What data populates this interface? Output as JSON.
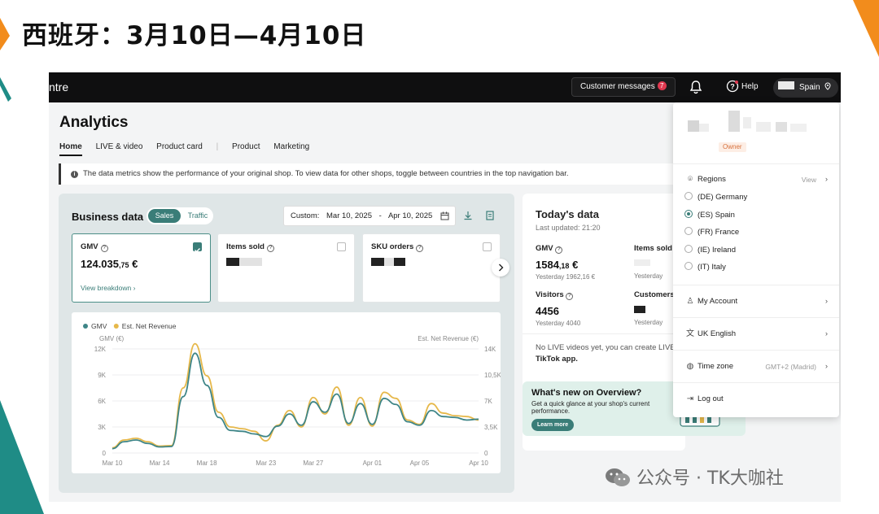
{
  "slide": {
    "title": "西班牙：3月10日—4月10日",
    "watermark": "公众号 · TK大咖社"
  },
  "topbar": {
    "brand_fragment": "ntre",
    "customer_messages": "Customer messages",
    "customer_messages_count": "7",
    "help": "Help",
    "region": "Spain"
  },
  "page": {
    "title": "Analytics",
    "tabs": [
      "Home",
      "LIVE & video",
      "Product card",
      "Product",
      "Marketing"
    ],
    "notice": "The data metrics show the performance of your original shop. To view data for other shops, toggle between countries in the top navigation bar."
  },
  "business": {
    "title": "Business data",
    "toggle": {
      "on": "Sales",
      "off": "Traffic"
    },
    "date": {
      "label": "Custom:",
      "start": "Mar 10, 2025",
      "dash": "-",
      "end": "Apr 10, 2025"
    },
    "cards": [
      {
        "label": "GMV",
        "value_main": "124.035",
        "value_dec": ",75",
        "currency": "€",
        "link": "View breakdown ›",
        "selected": true
      },
      {
        "label": "Items sold",
        "selected": false
      },
      {
        "label": "SKU orders",
        "selected": false
      }
    ]
  },
  "chart_data": {
    "type": "line",
    "title": "",
    "legend": [
      "GMV",
      "Est. Net Revenue"
    ],
    "ylabel_left": "GMV (€)",
    "ylabel_right": "Est. Net Revenue (€)",
    "x_ticks": [
      "Mar 10",
      "Mar 14",
      "Mar 18",
      "Mar 23",
      "Mar 27",
      "Apr 01",
      "Apr 05",
      "Apr 10"
    ],
    "y_ticks_left": [
      "12K",
      "9K",
      "6K",
      "3K",
      "0"
    ],
    "y_ticks_right": [
      "14K",
      "10,5K",
      "7K",
      "3,5K",
      "0"
    ],
    "ylim_left": [
      0,
      12000
    ],
    "colors": {
      "GMV": "#3e8587",
      "Est. Net Revenue": "#e6b84a"
    },
    "x": [
      "Mar 10",
      "Mar 11",
      "Mar 12",
      "Mar 13",
      "Mar 14",
      "Mar 15",
      "Mar 16",
      "Mar 17",
      "Mar 18",
      "Mar 19",
      "Mar 20",
      "Mar 21",
      "Mar 22",
      "Mar 23",
      "Mar 24",
      "Mar 25",
      "Mar 26",
      "Mar 27",
      "Mar 28",
      "Mar 29",
      "Mar 30",
      "Mar 31",
      "Apr 01",
      "Apr 02",
      "Apr 03",
      "Apr 04",
      "Apr 05",
      "Apr 06",
      "Apr 07",
      "Apr 08",
      "Apr 09",
      "Apr 10"
    ],
    "series": [
      {
        "name": "GMV",
        "values": [
          500,
          1300,
          1500,
          1100,
          700,
          750,
          6500,
          11500,
          7800,
          4100,
          2600,
          2500,
          2200,
          1900,
          3100,
          4500,
          3200,
          5900,
          4700,
          6800,
          3400,
          5700,
          3300,
          6300,
          5600,
          3600,
          3200,
          4900,
          4200,
          4100,
          3800,
          3900
        ]
      },
      {
        "name": "Est. Net Revenue",
        "values": [
          600,
          1500,
          1700,
          1300,
          800,
          850,
          7500,
          13300,
          8900,
          4700,
          3000,
          2800,
          2500,
          1400,
          3200,
          4900,
          3000,
          6400,
          4500,
          7600,
          3200,
          6400,
          3100,
          7000,
          6300,
          3800,
          3300,
          5700,
          4600,
          4300,
          4200,
          3800
        ]
      }
    ]
  },
  "today": {
    "title": "Today's data",
    "updated": "Last updated: 21:20",
    "gmv_label": "GMV",
    "gmv_main": "1584",
    "gmv_dec": ",18",
    "gmv_cur": "€",
    "gmv_yesterday": "Yesterday 1962,16 €",
    "items_label": "Items sold",
    "items_yesterday": "Yesterday",
    "visitors_label": "Visitors",
    "visitors_value": "4456",
    "visitors_yesterday": "Yesterday 4040",
    "customers_label": "Customers",
    "customers_yesterday": "Yesterday",
    "live_note": "No LIVE videos yet, you can create LIVE",
    "live_note_app": "TikTok app."
  },
  "whatsnew": {
    "title": "What's new on Overview?",
    "text": "Get a quick glance at your shop's current performance.",
    "button": "Learn more"
  },
  "dropdown": {
    "owner": "Owner",
    "regions_label": "Regions",
    "regions_view": "View",
    "regions": [
      {
        "label": "(DE) Germany",
        "selected": false
      },
      {
        "label": "(ES) Spain",
        "selected": true
      },
      {
        "label": "(FR) France",
        "selected": false
      },
      {
        "label": "(IE) Ireland",
        "selected": false
      },
      {
        "label": "(IT) Italy",
        "selected": false
      }
    ],
    "my_account": "My Account",
    "language": "UK English",
    "timezone_label": "Time zone",
    "timezone_value": "GMT+2 (Madrid)",
    "logout": "Log out"
  }
}
